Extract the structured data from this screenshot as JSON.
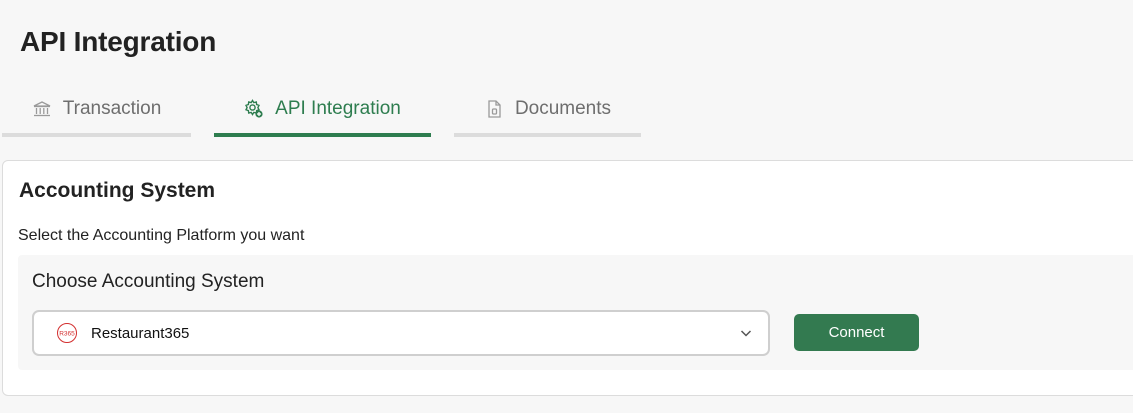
{
  "header": {
    "title": "API Integration"
  },
  "tabs": [
    {
      "label": "Transaction",
      "icon": "bank-icon",
      "active": false
    },
    {
      "label": "API Integration",
      "icon": "gear-plus-icon",
      "active": true
    },
    {
      "label": "Documents",
      "icon": "document-icon",
      "active": false
    }
  ],
  "card": {
    "title": "Accounting System",
    "subtitle": "Select the Accounting Platform you want",
    "section_title": "Choose Accounting System",
    "select": {
      "value": "Restaurant365",
      "logo": "restaurant365-logo",
      "logo_text": "R365"
    },
    "connect_label": "Connect"
  },
  "colors": {
    "accent": "#2e7d4f",
    "button": "#337a50",
    "logo": "#d32f2f"
  }
}
